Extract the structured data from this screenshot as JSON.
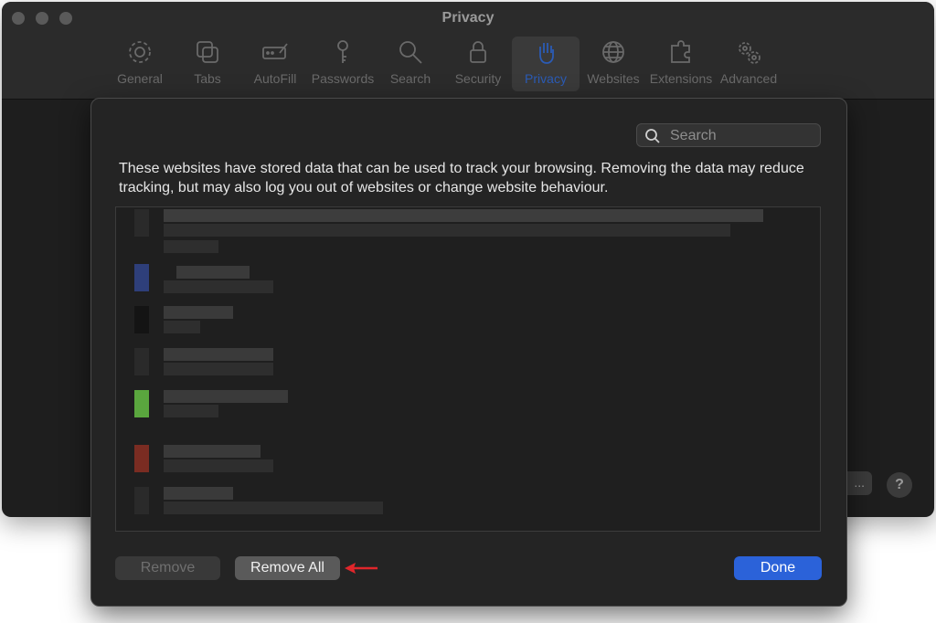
{
  "window": {
    "title": "Privacy"
  },
  "toolbar": {
    "items": [
      {
        "label": "General",
        "icon": "gear-icon"
      },
      {
        "label": "Tabs",
        "icon": "tabs-icon"
      },
      {
        "label": "AutoFill",
        "icon": "autofill-icon"
      },
      {
        "label": "Passwords",
        "icon": "key-icon"
      },
      {
        "label": "Search",
        "icon": "magnifier-icon"
      },
      {
        "label": "Security",
        "icon": "lock-icon"
      },
      {
        "label": "Privacy",
        "icon": "hand-icon",
        "selected": true
      },
      {
        "label": "Websites",
        "icon": "globe-icon"
      },
      {
        "label": "Extensions",
        "icon": "puzzle-icon"
      },
      {
        "label": "Advanced",
        "icon": "gears-icon"
      }
    ]
  },
  "background": {
    "details_button": "...",
    "help_button": "?"
  },
  "sheet": {
    "search_placeholder": "Search",
    "description": "These websites have stored data that can be used to track your browsing. Removing the data may reduce tracking, but may also log you out of websites or change website behaviour.",
    "buttons": {
      "remove": "Remove",
      "remove_all": "Remove All",
      "done": "Done"
    }
  },
  "colors": {
    "accent": "#2b62d9",
    "annotation_arrow": "#e0262b",
    "favicons": [
      "#2e3f7a",
      "#1a1a1a",
      "#2a2a2a",
      "#5aa63e",
      "#7a2c22",
      "#2a2a2a"
    ]
  }
}
